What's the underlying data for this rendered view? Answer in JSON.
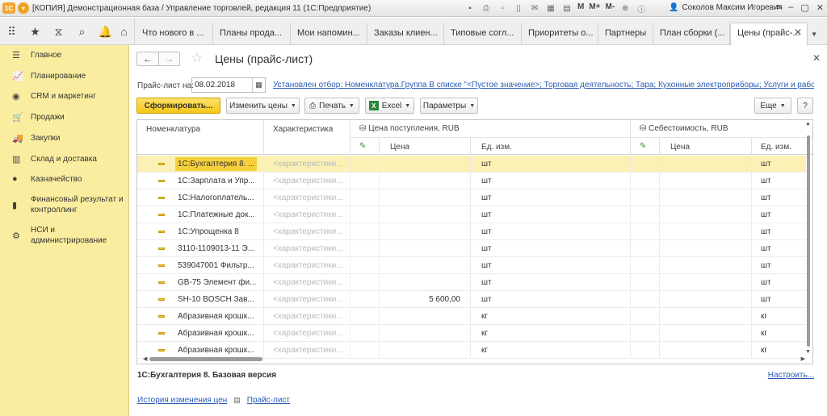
{
  "window": {
    "title": "[КОПИЯ] Демонстрационная база / Управление торговлей, редакция 11  (1С:Предприятие)",
    "logo_text": "1С",
    "toolbar_icons": [
      "disk-icon",
      "print-icon",
      "preview-icon",
      "bookmark-icon",
      "mail-icon",
      "calendar-icon",
      "calculator-icon"
    ],
    "memory_buttons": [
      "M",
      "M+",
      "M-"
    ],
    "user_name": "Соколов Максим Игоревич"
  },
  "tabs": [
    {
      "label": "Что нового в ..."
    },
    {
      "label": "Планы прода..."
    },
    {
      "label": "Мои напомин..."
    },
    {
      "label": "Заказы клиен..."
    },
    {
      "label": "Типовые согл..."
    },
    {
      "label": "Приоритеты о..."
    },
    {
      "label": "Партнеры"
    },
    {
      "label": "План сборки (..."
    },
    {
      "label": "Цены (прайс-..."
    }
  ],
  "sidebar": {
    "items": [
      {
        "label": "Главное",
        "icon": "menu-icon"
      },
      {
        "label": "Планирование",
        "icon": "planning-icon"
      },
      {
        "label": "CRM и маркетинг",
        "icon": "crm-icon"
      },
      {
        "label": "Продажи",
        "icon": "sales-icon"
      },
      {
        "label": "Закупки",
        "icon": "purchases-icon"
      },
      {
        "label": "Склад и доставка",
        "icon": "warehouse-icon"
      },
      {
        "label": "Казначейство",
        "icon": "treasury-icon"
      },
      {
        "label": "Финансовый результат и контроллинг",
        "icon": "finance-icon"
      },
      {
        "label": "НСИ и администрирование",
        "icon": "gear-icon"
      }
    ]
  },
  "form": {
    "title": "Цены (прайс-лист)",
    "price_list_label": "Прайс-лист на:",
    "price_list_date": "08.02.2018",
    "filter_text": "Установлен отбор: Номенклатура.Группа В списке \"<Пустое значение>; Торговая деятельность; Тара; Кухонные электроприборы; Услуги и работы;..."
  },
  "toolbar": {
    "generate": "Сформировать...",
    "change_prices": "Изменить цены",
    "print": "Печать",
    "excel": "Excel",
    "excel_badge": "X",
    "params": "Параметры",
    "more": "Еще",
    "help": "?"
  },
  "grid": {
    "headers": {
      "nomenclature": "Номенклатура",
      "characteristic": "Характеристика",
      "group1": "Цена поступления, RUB",
      "group2": "Себестоимость, RUB",
      "price": "Цена",
      "unit": "Ед. изм."
    },
    "rows": [
      {
        "name": "1С:Бухгалтерия 8. ...",
        "char": "<характеристики...",
        "price1": "",
        "unit1": "шт",
        "price2": "",
        "unit2": "шт"
      },
      {
        "name": "1С:Зарплата и Упр...",
        "char": "<характеристики...",
        "price1": "",
        "unit1": "шт",
        "price2": "",
        "unit2": "шт"
      },
      {
        "name": "1С:Налогоплатель...",
        "char": "<характеристики...",
        "price1": "",
        "unit1": "шт",
        "price2": "",
        "unit2": "шт"
      },
      {
        "name": "1С:Платежные док...",
        "char": "<характеристики...",
        "price1": "",
        "unit1": "шт",
        "price2": "",
        "unit2": "шт"
      },
      {
        "name": "1С:Упрощенка 8",
        "char": "<характеристики...",
        "price1": "",
        "unit1": "шт",
        "price2": "",
        "unit2": "шт"
      },
      {
        "name": "3110-1109013-11 Э...",
        "char": "<характеристики...",
        "price1": "",
        "unit1": "шт",
        "price2": "",
        "unit2": "шт"
      },
      {
        "name": "539047001 Фильтр...",
        "char": "<характеристики...",
        "price1": "",
        "unit1": "шт",
        "price2": "",
        "unit2": "шт"
      },
      {
        "name": "GB-75 Элемент фи...",
        "char": "<характеристики...",
        "price1": "",
        "unit1": "шт",
        "price2": "",
        "unit2": "шт"
      },
      {
        "name": "SH-10 BOSCH Зав...",
        "char": "<характеристики...",
        "price1": "5 600,00",
        "unit1": "шт",
        "price2": "",
        "unit2": "шт"
      },
      {
        "name": "Абразивная крошк...",
        "char": "<характеристики...",
        "price1": "",
        "unit1": "кг",
        "price2": "",
        "unit2": "кг"
      },
      {
        "name": "Абразивная крошк...",
        "char": "<характеристики...",
        "price1": "",
        "unit1": "кг",
        "price2": "",
        "unit2": "кг"
      },
      {
        "name": "Абразивная крошк...",
        "char": "<характеристики...",
        "price1": "",
        "unit1": "кг",
        "price2": "",
        "unit2": "кг"
      }
    ]
  },
  "footer": {
    "selected_title": "1С:Бухгалтерия 8. Базовая версия",
    "setup_link": "Настроить...",
    "history_link": "История изменения цен",
    "price_list_link": "Прайс-лист"
  },
  "colors": {
    "sidebar_bg": "#fbeda0",
    "primary_button": "#f6c516",
    "selected_row": "#fbf1b4",
    "link": "#2a5bb5"
  }
}
